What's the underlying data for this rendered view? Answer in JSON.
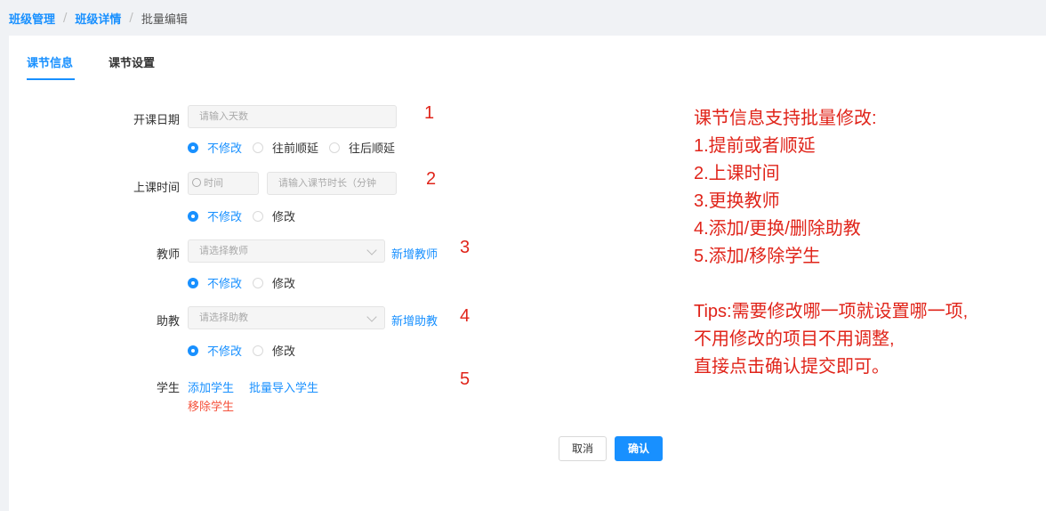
{
  "breadcrumb": {
    "item1": "班级管理",
    "item2": "班级详情",
    "current": "批量编辑",
    "separator": "/"
  },
  "tabs": [
    {
      "label": "课节信息",
      "active": true
    },
    {
      "label": "课节设置",
      "active": false
    }
  ],
  "form": {
    "start_date": {
      "label": "开课日期",
      "placeholder": "请输入天数",
      "options": [
        "不修改",
        "往前顺延",
        "往后顺延"
      ],
      "selected": "不修改"
    },
    "class_time": {
      "label": "上课时间",
      "time_placeholder": "时间",
      "duration_placeholder": "请输入课节时长（分钟",
      "options": [
        "不修改",
        "修改"
      ],
      "selected": "不修改"
    },
    "teacher": {
      "label": "教师",
      "placeholder": "请选择教师",
      "add_link": "新增教师",
      "options": [
        "不修改",
        "修改"
      ],
      "selected": "不修改"
    },
    "assistant": {
      "label": "助教",
      "placeholder": "请选择助教",
      "add_link": "新增助教",
      "options": [
        "不修改",
        "修改"
      ],
      "selected": "不修改"
    },
    "students": {
      "label": "学生",
      "add_link": "添加学生",
      "import_link": "批量导入学生",
      "remove_link": "移除学生"
    }
  },
  "annotations": [
    "1",
    "2",
    "3",
    "4",
    "5"
  ],
  "buttons": {
    "cancel": "取消",
    "confirm": "确认"
  },
  "note": {
    "lines": [
      "课节信息支持批量修改:",
      "1.提前或者顺延",
      "2.上课时间",
      "3.更换教师",
      "4.添加/更换/删除助教",
      "5.添加/移除学生",
      "",
      "Tips:需要修改哪一项就设置哪一项,",
      "不用修改的项目不用调整,",
      "直接点击确认提交即可。"
    ]
  },
  "colors": {
    "accent": "#1890ff",
    "annotation_red": "#e0241a",
    "remove_red": "#f5533d"
  }
}
